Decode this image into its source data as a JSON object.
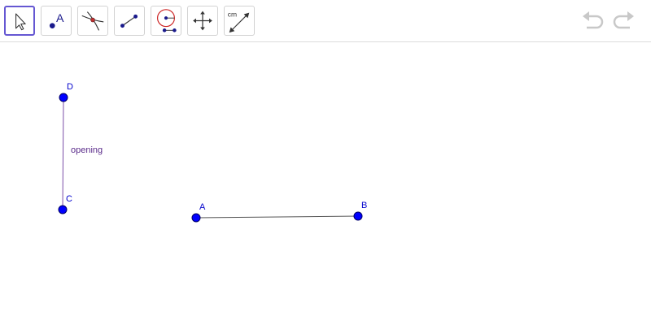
{
  "toolbar": {
    "tools": [
      {
        "name": "move-tool",
        "icon": "arrow-pointer-icon",
        "selected": true
      },
      {
        "name": "point-tool",
        "icon": "point-icon",
        "label": "A"
      },
      {
        "name": "intersect-tool",
        "icon": "intersect-icon"
      },
      {
        "name": "segment-tool",
        "icon": "segment-icon"
      },
      {
        "name": "compass-tool",
        "icon": "compass-icon"
      },
      {
        "name": "move-graphics-view-tool",
        "icon": "move-cross-icon"
      },
      {
        "name": "distance-tool",
        "icon": "distance-icon",
        "label": "cm"
      }
    ],
    "undo_icon": "undo-icon",
    "redo_icon": "redo-icon"
  },
  "canvas": {
    "points": {
      "D": {
        "label": "D"
      },
      "C": {
        "label": "C"
      },
      "A": {
        "label": "A"
      },
      "B": {
        "label": "B"
      }
    },
    "segment_label": "opening"
  },
  "colors": {
    "point_fill": "#0000ff",
    "point_label": "#0000cc",
    "segment_cd": "#7b4fa8",
    "segment_ab": "#555555",
    "segment_label": "#5a2b8a",
    "tool_selected_border": "#6557d2"
  }
}
